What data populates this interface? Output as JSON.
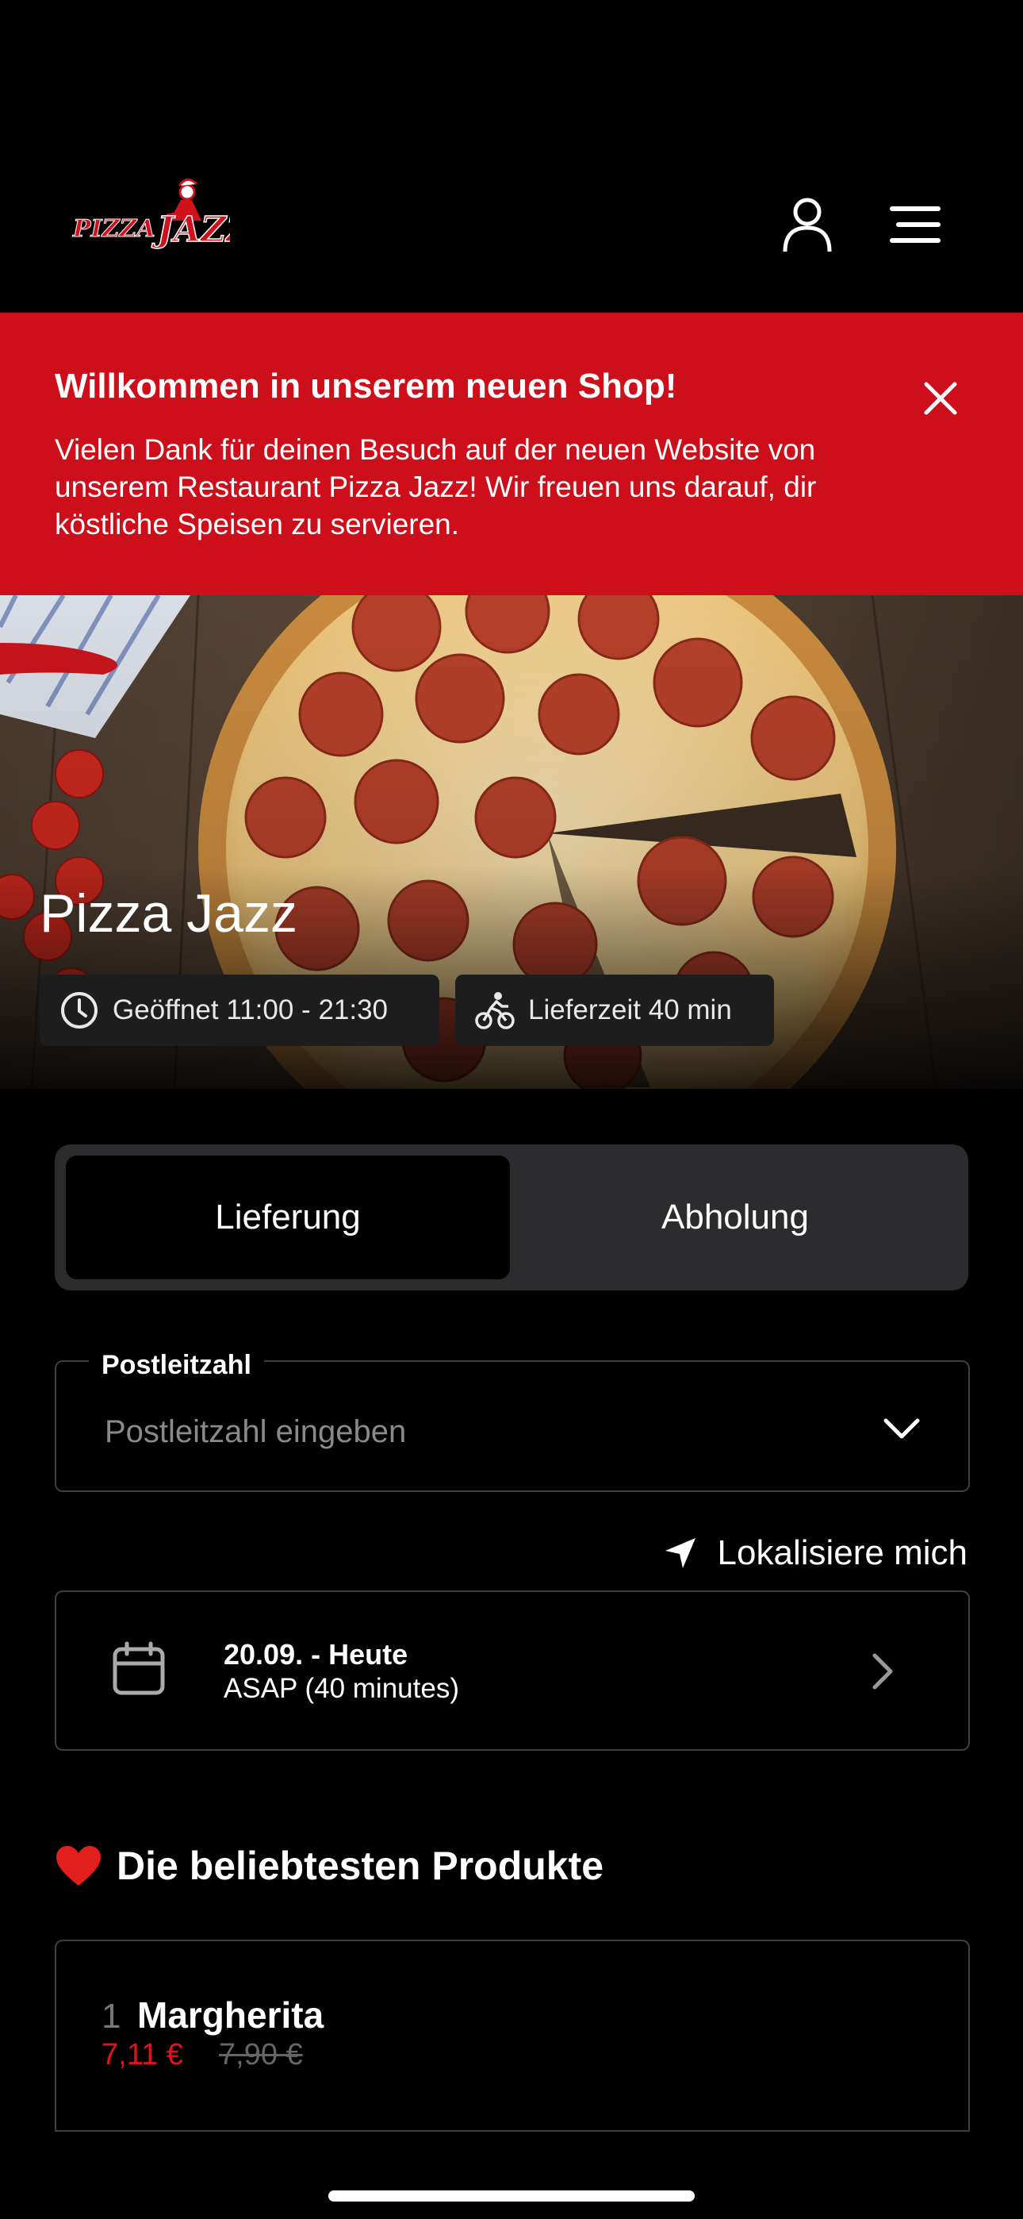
{
  "header": {
    "logo_text": "PIZZA JAZZ",
    "user_icon": "user-icon",
    "menu_icon": "menu-icon"
  },
  "banner": {
    "title": "Willkommen in unserem neuen Shop!",
    "text": "Vielen Dank für deinen Besuch auf der neuen Website von unserem Restaurant Pizza Jazz! Wir freuen uns darauf, dir köstliche Speisen zu servieren.",
    "close_icon": "close-icon",
    "color": "#cd0f1b"
  },
  "hero": {
    "title": "Pizza Jazz",
    "opening": "Geöffnet 11:00 - 21:30",
    "delivery_time": "Lieferzeit 40 min"
  },
  "order_mode": {
    "options": [
      "Lieferung",
      "Abholung"
    ],
    "selected": "Lieferung"
  },
  "postal": {
    "label": "Postleitzahl",
    "placeholder": "Postleitzahl eingeben",
    "value": ""
  },
  "locate": {
    "label": "Lokalisiere mich"
  },
  "schedule": {
    "date": "20.09. - Heute",
    "time": "ASAP (40 minutes)"
  },
  "popular": {
    "title": "Die beliebtesten Produkte",
    "products": [
      {
        "rank": "1",
        "name": "Margherita",
        "price": "7,11 €",
        "old_price": "7,90 €"
      }
    ]
  },
  "colors": {
    "accent": "#cd0f1b",
    "price": "#e0121e",
    "background": "#000000"
  }
}
